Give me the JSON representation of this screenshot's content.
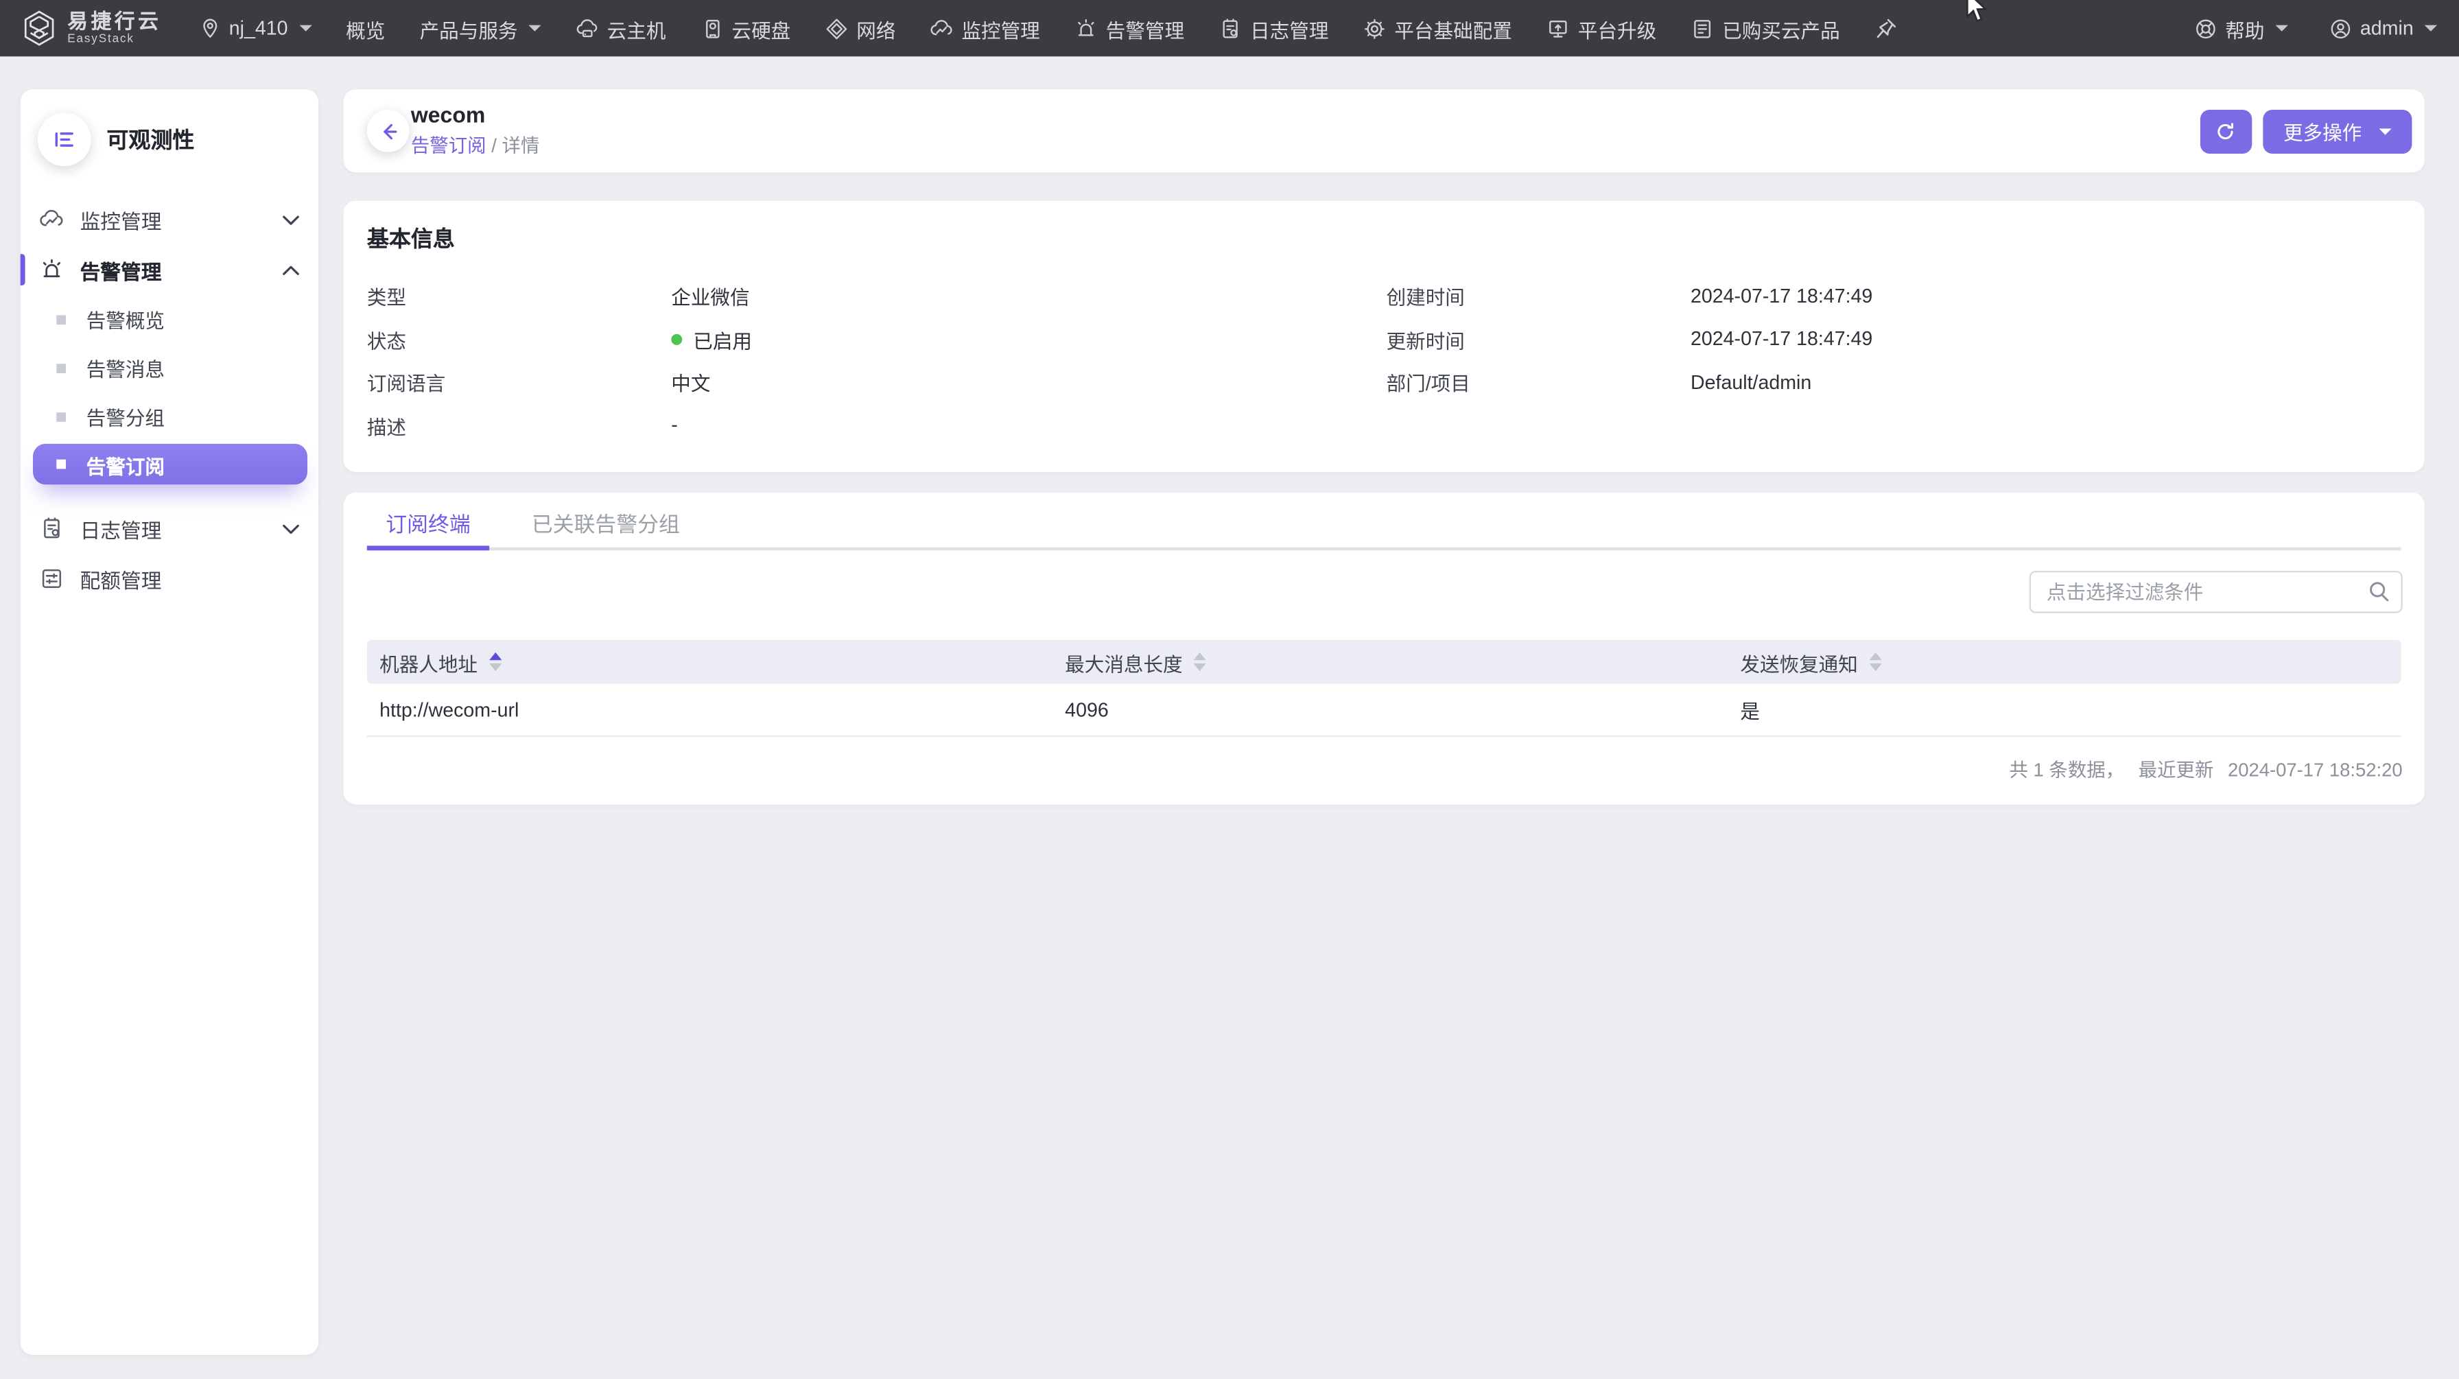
{
  "colors": {
    "accent": "#7b6ce6",
    "sidebar_selected": "#8477e8",
    "status_green": "#4cc44f",
    "navbar_bg": "#3b3c42"
  },
  "navbar": {
    "brand_line1": "易捷行云",
    "brand_line2": "EasyStack",
    "region": "nj_410",
    "menu": {
      "overview": "概览",
      "products": "产品与服务",
      "host": "云主机",
      "disk": "云硬盘",
      "network": "网络",
      "monitor": "监控管理",
      "alarm": "告警管理",
      "log": "日志管理",
      "platform_config": "平台基础配置",
      "platform_upgrade": "平台升级",
      "purchased": "已购买云产品"
    },
    "help": "帮助",
    "user": "admin"
  },
  "sidebar": {
    "title": "可观测性",
    "monitor_group": "监控管理",
    "alarm_group": "告警管理",
    "alarm_children": {
      "overview": "告警概览",
      "message": "告警消息",
      "group": "告警分组",
      "subscription": "告警订阅"
    },
    "log_group": "日志管理",
    "quota": "配额管理"
  },
  "page": {
    "title": "wecom",
    "breadcrumb_parent": "告警订阅",
    "breadcrumb_sep": "/",
    "breadcrumb_current": "详情",
    "more_actions": "更多操作"
  },
  "basic_info": {
    "title": "基本信息",
    "type_label": "类型",
    "type_value": "企业微信",
    "status_label": "状态",
    "status_value": "已启用",
    "lang_label": "订阅语言",
    "lang_value": "中文",
    "desc_label": "描述",
    "desc_value": "-",
    "created_label": "创建时间",
    "created_value": "2024-07-17 18:47:49",
    "updated_label": "更新时间",
    "updated_value": "2024-07-17 18:47:49",
    "dept_label": "部门/项目",
    "dept_value": "Default/admin"
  },
  "tabs": {
    "terminal": "订阅终端",
    "groups": "已关联告警分组"
  },
  "filter": {
    "placeholder": "点击选择过滤条件"
  },
  "table": {
    "col_address": "机器人地址",
    "col_maxlen": "最大消息长度",
    "col_recovery": "发送恢复通知",
    "row_address": "http://wecom-url",
    "row_maxlen": "4096",
    "row_recovery": "是",
    "footer_count": "共 1 条数据，",
    "footer_updated_label": "最近更新",
    "footer_updated_time": "2024-07-17 18:52:20"
  }
}
